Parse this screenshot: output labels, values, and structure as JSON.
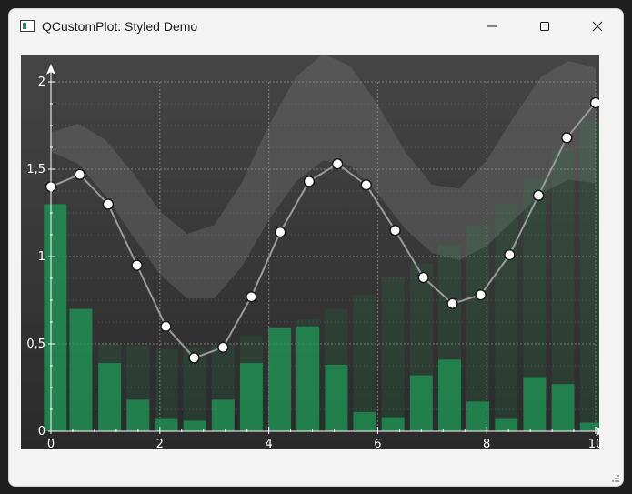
{
  "window": {
    "title": "QCustomPlot: Styled Demo",
    "controls": [
      "minimize",
      "maximize",
      "close"
    ]
  },
  "colors": {
    "plot_background_top": "#444444",
    "plot_background_bottom": "#2a2a2a",
    "line": "#9a9a9a",
    "bars": "#1f9a57",
    "band": "#777777",
    "axis": "#ffffff",
    "grid": "#8a8a8a"
  },
  "chart_data": {
    "type": "line",
    "xlim": [
      0,
      10
    ],
    "ylim": [
      0,
      2
    ],
    "x_ticks": [
      0,
      2,
      4,
      6,
      8,
      10
    ],
    "x_tick_labels": [
      "0",
      "2",
      "4",
      "6",
      "8",
      "10"
    ],
    "y_ticks": [
      0,
      0.5,
      1,
      1.5,
      2
    ],
    "y_tick_labels": [
      "0",
      "0,5",
      "1",
      "1,5",
      "2"
    ],
    "grid": true,
    "series": [
      {
        "kind": "line",
        "x": [
          0,
          0.53,
          1.05,
          1.58,
          2.11,
          2.63,
          3.16,
          3.68,
          4.21,
          4.74,
          5.26,
          5.79,
          6.32,
          6.84,
          7.37,
          7.89,
          8.42,
          8.95,
          9.47,
          10
        ],
        "values": [
          1.4,
          1.47,
          1.3,
          0.95,
          0.6,
          0.42,
          0.48,
          0.77,
          1.14,
          1.43,
          1.53,
          1.41,
          1.15,
          0.88,
          0.73,
          0.78,
          1.01,
          1.35,
          1.68,
          1.88
        ]
      },
      {
        "kind": "bar",
        "x": [
          0.08,
          0.55,
          1.08,
          1.6,
          2.12,
          2.64,
          3.16,
          3.68,
          4.2,
          4.72,
          5.24,
          5.76,
          6.28,
          6.8,
          7.32,
          7.84,
          8.36,
          8.88,
          9.4,
          9.92
        ],
        "values": [
          1.3,
          0.7,
          0.39,
          0.18,
          0.07,
          0.06,
          0.18,
          0.39,
          0.59,
          0.6,
          0.38,
          0.11,
          0.08,
          0.32,
          0.41,
          0.17,
          0.07,
          0.31,
          0.27,
          0.05
        ]
      },
      {
        "kind": "bar-faint",
        "x": [
          0.08,
          0.55,
          1.08,
          1.6,
          2.12,
          2.64,
          3.16,
          3.68,
          4.2,
          4.72,
          5.24,
          5.76,
          6.28,
          6.8,
          7.32,
          7.84,
          8.36,
          8.88,
          9.4,
          9.92
        ],
        "values": [
          1.3,
          0.7,
          0.5,
          0.49,
          0.47,
          0.48,
          0.5,
          0.55,
          0.6,
          0.64,
          0.7,
          0.78,
          0.88,
          0.96,
          1.07,
          1.18,
          1.3,
          1.45,
          1.62,
          1.78
        ]
      },
      {
        "kind": "band",
        "x": [
          0,
          0.5,
          1,
          1.5,
          2,
          2.5,
          3,
          3.5,
          4,
          4.5,
          5,
          5.5,
          6,
          6.5,
          7,
          7.5,
          8,
          8.5,
          9,
          9.5,
          10
        ],
        "upper": [
          1.71,
          1.76,
          1.67,
          1.48,
          1.26,
          1.13,
          1.18,
          1.42,
          1.75,
          2.03,
          2.16,
          2.09,
          1.87,
          1.6,
          1.41,
          1.39,
          1.55,
          1.8,
          2.03,
          2.12,
          2.08
        ],
        "lower": [
          1.6,
          1.53,
          1.35,
          1.12,
          0.9,
          0.76,
          0.76,
          0.94,
          1.21,
          1.43,
          1.55,
          1.52,
          1.36,
          1.16,
          1.02,
          0.98,
          1.06,
          1.21,
          1.36,
          1.44,
          1.42
        ]
      }
    ]
  }
}
